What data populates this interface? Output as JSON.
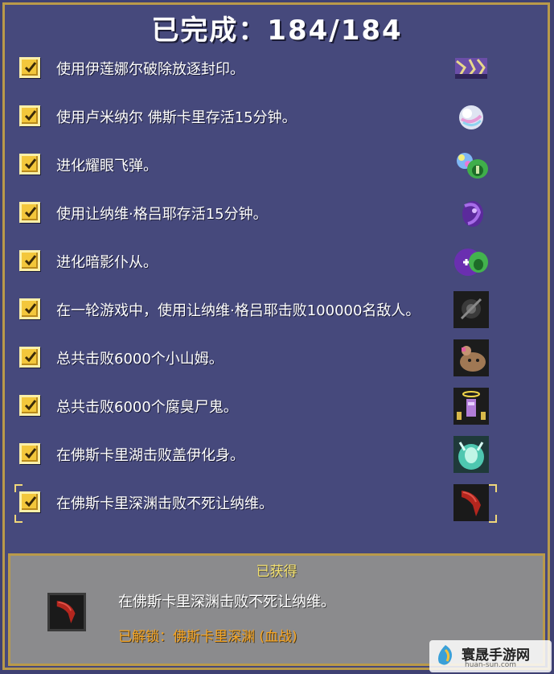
{
  "header": {
    "title": "已完成：184/184"
  },
  "achievements": [
    {
      "label": "使用伊莲娜尔破除放逐封印。",
      "icon": "broken-seal-icon",
      "checked": true
    },
    {
      "label": "使用卢米纳尔 佛斯卡里存活15分钟。",
      "icon": "prism-orb-icon",
      "checked": true
    },
    {
      "label": "进化耀眼飞弹。",
      "icon": "dazzling-missile-icon",
      "checked": true
    },
    {
      "label": "使用让纳维·格吕耶存活15分钟。",
      "icon": "purple-shadow-icon",
      "checked": true
    },
    {
      "label": "进化暗影仆从。",
      "icon": "shadow-servant-icon",
      "checked": true
    },
    {
      "label": "在一轮游戏中，使用让纳维·格吕耶击败100000名敌人。",
      "icon": "dark-skull-icon",
      "checked": true
    },
    {
      "label": "总共击败6000个小山姆。",
      "icon": "little-sam-icon",
      "checked": true
    },
    {
      "label": "总共击败6000个腐臭尸鬼。",
      "icon": "ghoul-angel-icon",
      "checked": true
    },
    {
      "label": "在佛斯卡里湖击败盖伊化身。",
      "icon": "lake-spirit-icon",
      "checked": true
    },
    {
      "label": "在佛斯卡里深渊击败不死让纳维。",
      "icon": "red-claw-icon",
      "checked": true,
      "selected": true
    }
  ],
  "footer": {
    "title": "已获得",
    "icon": "red-claw-icon",
    "description": "在佛斯卡里深渊击败不死让纳维。",
    "unlock": "已解锁：佛斯卡里深渊 (血战)"
  },
  "watermark": {
    "name": "寰晟手游网",
    "url": "huan-sun.com"
  }
}
